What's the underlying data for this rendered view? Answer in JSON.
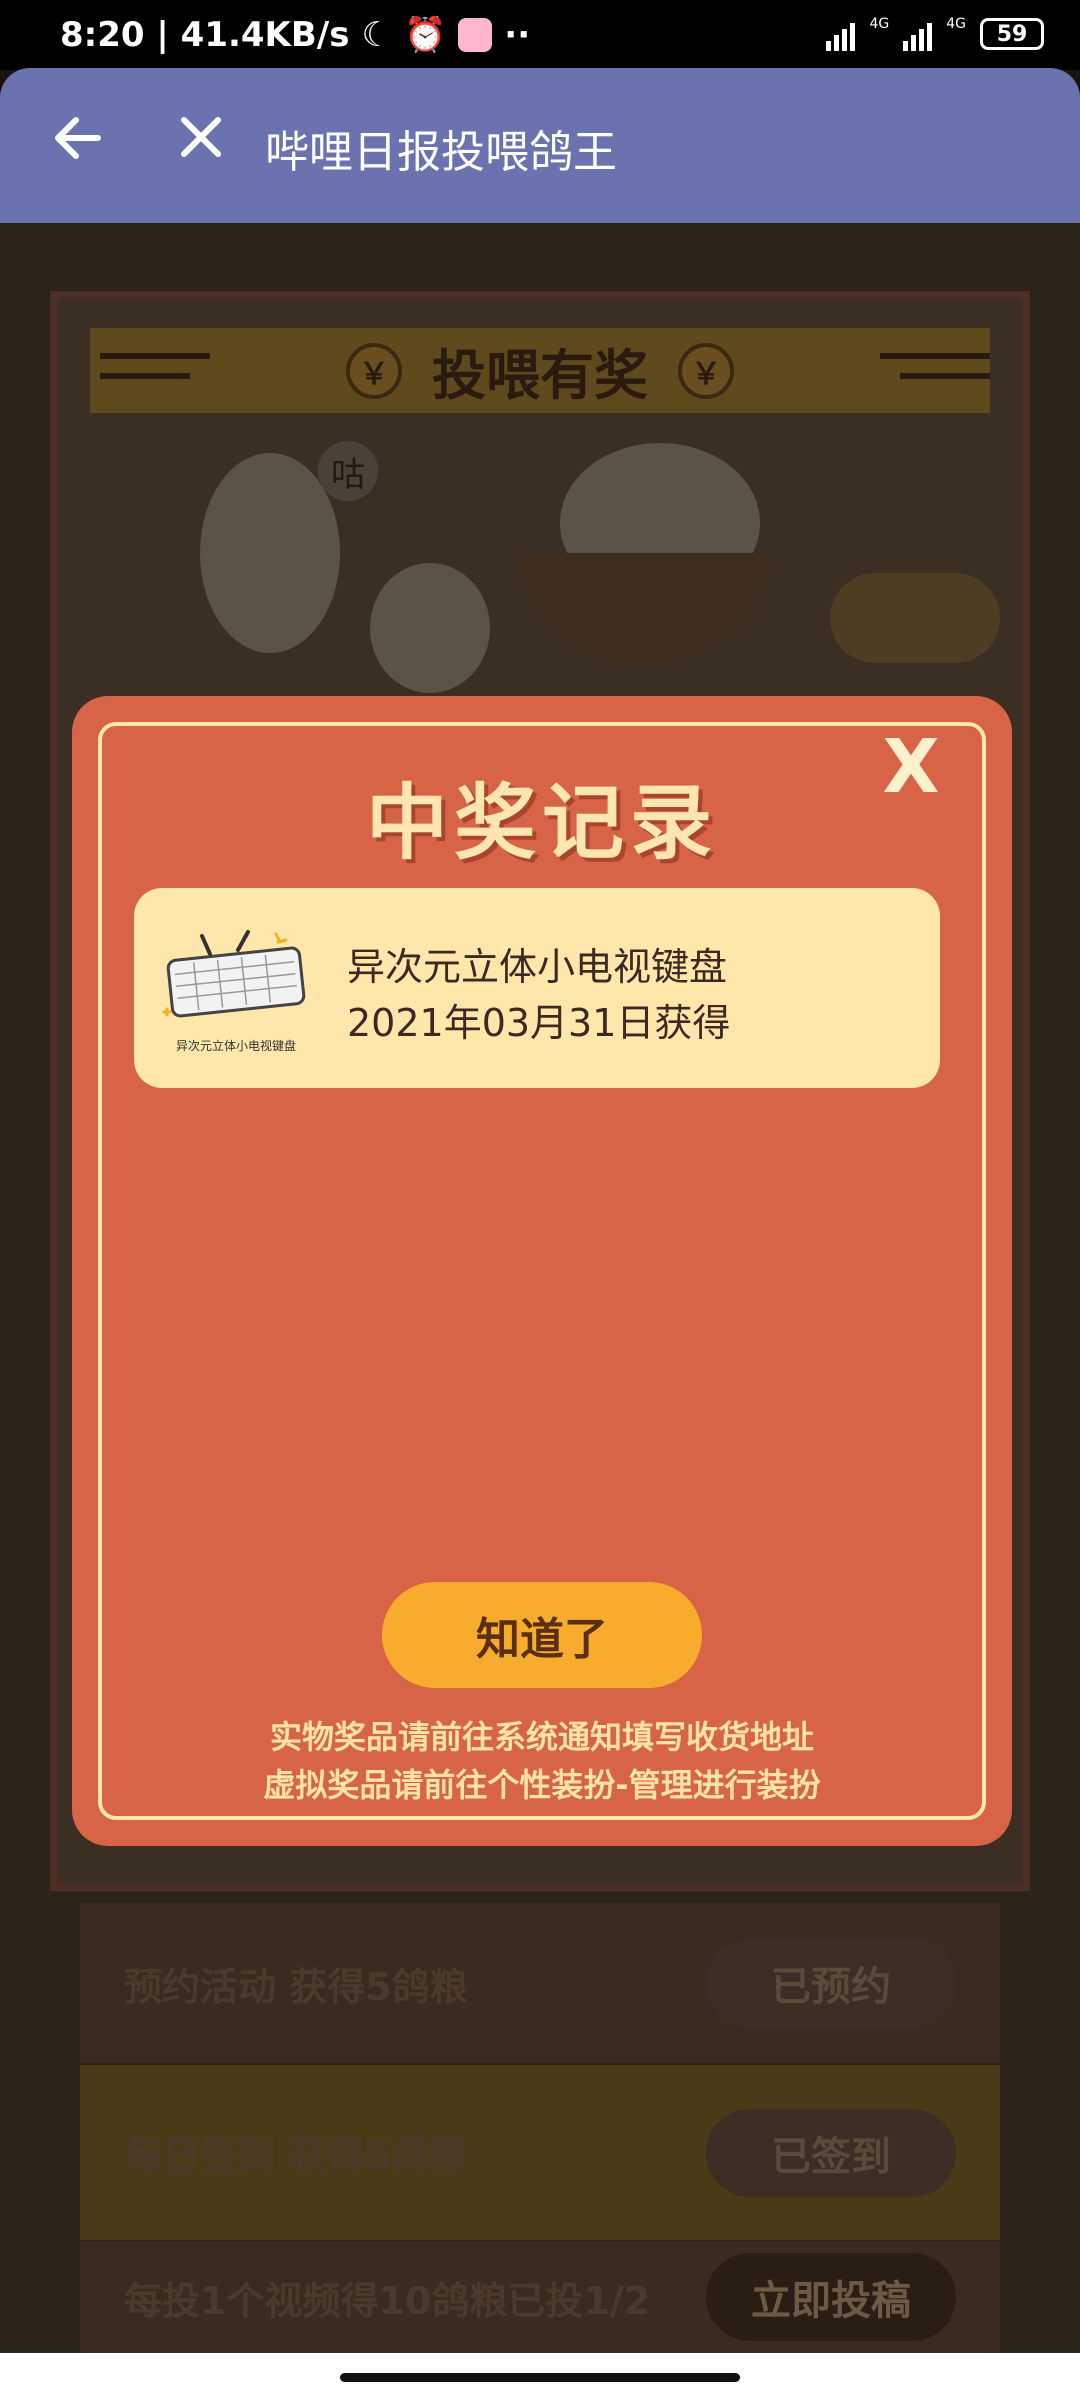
{
  "status_bar": {
    "time_speed": "8:20 | 41.4KB/s",
    "network_1": "4G",
    "network_2": "4G",
    "battery": "59"
  },
  "header": {
    "title": "哔哩日报投喂鸽王",
    "back_icon": "arrow-left-icon",
    "close_icon": "close-icon"
  },
  "background": {
    "banner_text": "投喂有奖",
    "coin_symbol": "￥",
    "bubble_text": "咕",
    "tasks": [
      {
        "label": "预约活动 获得5鸽粮",
        "button": "已预约"
      },
      {
        "label": "每日签到 获得5鸽粮",
        "button": "已签到"
      },
      {
        "label": "每投1个视频得10鸽粮已投1/2",
        "button": "立即投稿"
      }
    ]
  },
  "modal": {
    "title": "中奖记录",
    "close_label": "X",
    "prizes": [
      {
        "name": "异次元立体小电视键盘",
        "date": "2021年03月31日获得",
        "thumb_caption": "异次元立体小电视键盘"
      }
    ],
    "confirm_label": "知道了",
    "note_1": "实物奖品请前往系统通知填写收货地址",
    "note_2": "虚拟奖品请前往个性装扮-管理进行装扮"
  }
}
